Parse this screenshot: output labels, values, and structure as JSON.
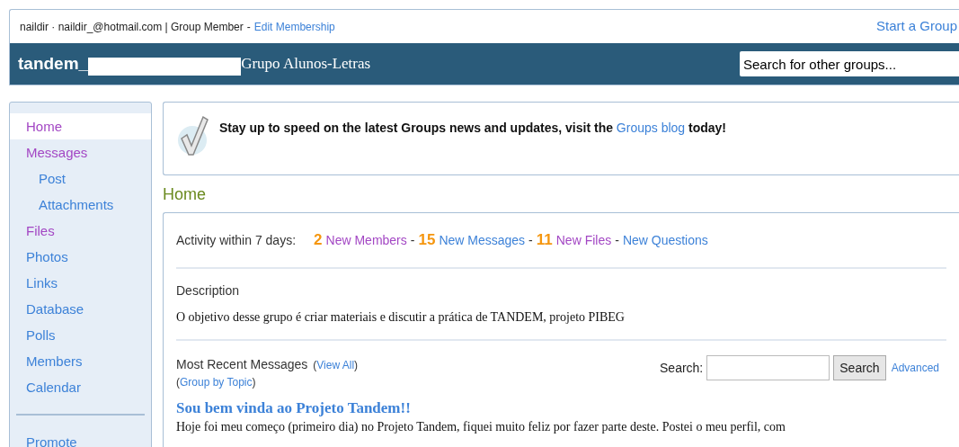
{
  "account": {
    "user": "naildir · naildir_@hotmail.com | Group Member",
    "separator": "-",
    "edit_link": "Edit Membership",
    "start_link": "Start a Group"
  },
  "header": {
    "group_prefix": "tandem_",
    "group_suffix": "Grupo Alunos-Letras",
    "redacted": true,
    "search_placeholder": "Search for other groups..."
  },
  "sidebar": {
    "items": [
      {
        "label": "Home",
        "selected": true,
        "visited": true
      },
      {
        "label": "Messages",
        "selected": false,
        "visited": true,
        "children": [
          {
            "label": "Post",
            "selected": false,
            "visited": false
          },
          {
            "label": "Attachments",
            "selected": false,
            "visited": false
          }
        ]
      },
      {
        "label": "Files",
        "selected": false,
        "visited": true
      },
      {
        "label": "Photos",
        "selected": false,
        "visited": false
      },
      {
        "label": "Links",
        "selected": false,
        "visited": false
      },
      {
        "label": "Database",
        "selected": false,
        "visited": false
      },
      {
        "label": "Polls",
        "selected": false,
        "visited": false
      },
      {
        "label": "Members",
        "selected": false,
        "visited": false
      },
      {
        "label": "Calendar",
        "selected": false,
        "visited": false
      }
    ],
    "extra": [
      {
        "label": "Promote",
        "selected": false,
        "visited": false
      }
    ]
  },
  "notice": {
    "before": "Stay up to speed on the latest Groups news and updates, visit the",
    "link": "Groups blog",
    "after": "today!"
  },
  "page_title": "Home",
  "activity": {
    "label": "Activity within 7 days:",
    "items": [
      {
        "count": "2",
        "label": "New Members",
        "visited": true
      },
      {
        "count": "15",
        "label": "New Messages",
        "visited": false
      },
      {
        "count": "11",
        "label": "New Files",
        "visited": true
      },
      {
        "label": "New Questions",
        "visited": false
      }
    ],
    "separator": "-"
  },
  "description": {
    "heading": "Description",
    "text": "O objetivo desse grupo é criar materiais e discutir a prática de TANDEM, projeto PIBEG"
  },
  "recent": {
    "heading": "Most Recent Messages",
    "paren_open": "(",
    "paren_close": ")",
    "view_all": "View All",
    "group_by": "Group by Topic",
    "search_label": "Search:",
    "search_button": "Search",
    "advanced": "Advanced",
    "messages": [
      {
        "title": "Sou bem vinda ao Projeto Tandem!!",
        "body": "Hoje foi meu começo (primeiro dia) no Projeto Tandem, fiquei muito feliz por fazer parte deste. Postei o meu perfil, com"
      }
    ]
  }
}
